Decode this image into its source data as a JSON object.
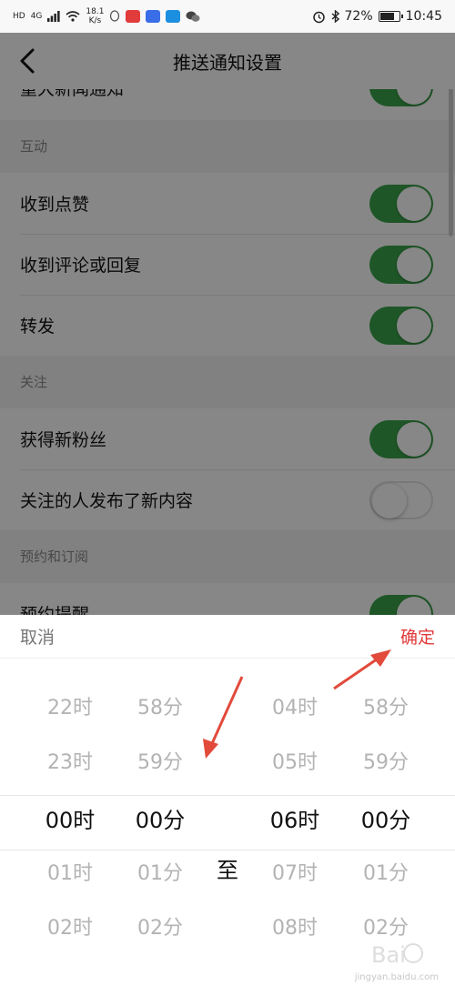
{
  "status": {
    "hd": "HD",
    "network": "4G",
    "speed_value": "18.1",
    "speed_unit": "K/s",
    "battery": "72%",
    "time": "10:45"
  },
  "nav": {
    "title": "推送通知设置"
  },
  "settings": {
    "partial_top": {
      "label": "重大新闻通知",
      "on": true
    },
    "section_interaction": "互动",
    "interaction": [
      "收到点赞",
      "收到评论或回复",
      "转发"
    ],
    "section_follow": "关注",
    "follow": [
      "获得新粉丝",
      "关注的人发布了新内容"
    ],
    "section_booking": "预约和订阅",
    "booking": [
      "预约提醒"
    ],
    "toggle_states": {
      "收到点赞": true,
      "收到评论或回复": true,
      "转发": true,
      "获得新粉丝": true,
      "关注的人发布了新内容": false,
      "预约提醒": true
    }
  },
  "picker": {
    "cancel": "取消",
    "confirm": "确定",
    "separator": "至",
    "columns": [
      {
        "name": "start-hour",
        "items": [
          "22时",
          "23时",
          "00时",
          "01时",
          "02时"
        ],
        "selected": "00时"
      },
      {
        "name": "start-minute",
        "items": [
          "58分",
          "59分",
          "00分",
          "01分",
          "02分"
        ],
        "selected": "00分"
      },
      {
        "name": "end-hour",
        "items": [
          "04时",
          "05时",
          "06时",
          "07时",
          "08时"
        ],
        "selected": "06时"
      },
      {
        "name": "end-minute",
        "items": [
          "58分",
          "59分",
          "00分",
          "01分",
          "02分"
        ],
        "selected": "00分"
      }
    ]
  },
  "colors": {
    "toggle_on": "#3aa34a",
    "confirm": "#e03a3a",
    "annotation_arrow": "#e24a3b",
    "overlay": "rgba(0,0,0,0.47)"
  },
  "icons": [
    "back-arrow-icon",
    "signal-icon",
    "wifi-icon",
    "alarm-icon",
    "bluetooth-icon",
    "battery-icon",
    "wechat-icon"
  ],
  "watermark": {
    "url": "jingyan.baidu.com"
  }
}
